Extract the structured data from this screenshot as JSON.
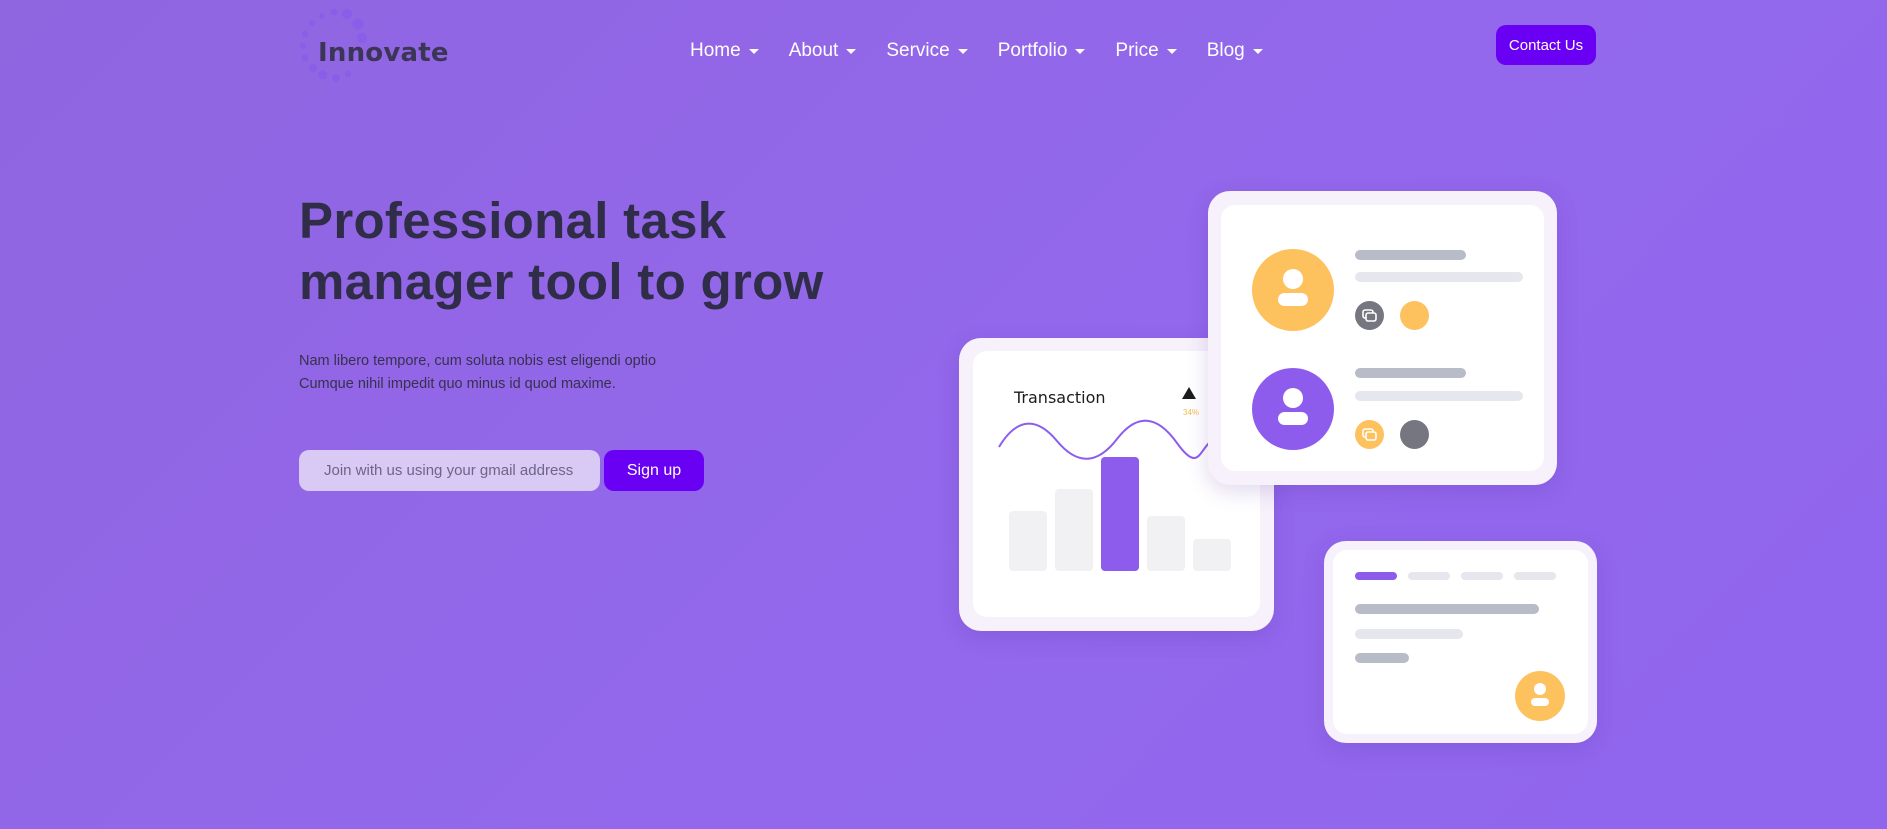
{
  "brand": {
    "name": "Innovate"
  },
  "nav": {
    "items": [
      {
        "label": "Home"
      },
      {
        "label": "About"
      },
      {
        "label": "Service"
      },
      {
        "label": "Portfolio"
      },
      {
        "label": "Price"
      },
      {
        "label": "Blog"
      }
    ]
  },
  "header": {
    "contact_label": "Contact Us"
  },
  "hero": {
    "title": "Professional task manager tool to grow",
    "description_lines": [
      "Nam libero tempore, cum soluta nobis est eligendi optio",
      "Cumque nihil impedit quo minus id quod maxime."
    ],
    "email_placeholder": "Join with us using your gmail address",
    "signup_label": "Sign up"
  },
  "illustration": {
    "transaction": {
      "title": "Transaction",
      "change_text": "34%",
      "trend": "up-triangle-icon"
    }
  },
  "colors": {
    "background": "#9066e6",
    "accent": "#6a00f3",
    "heading": "#2f2d48",
    "purple": "#8d5ced",
    "yellow": "#fdc15e",
    "gray": "#757680"
  }
}
